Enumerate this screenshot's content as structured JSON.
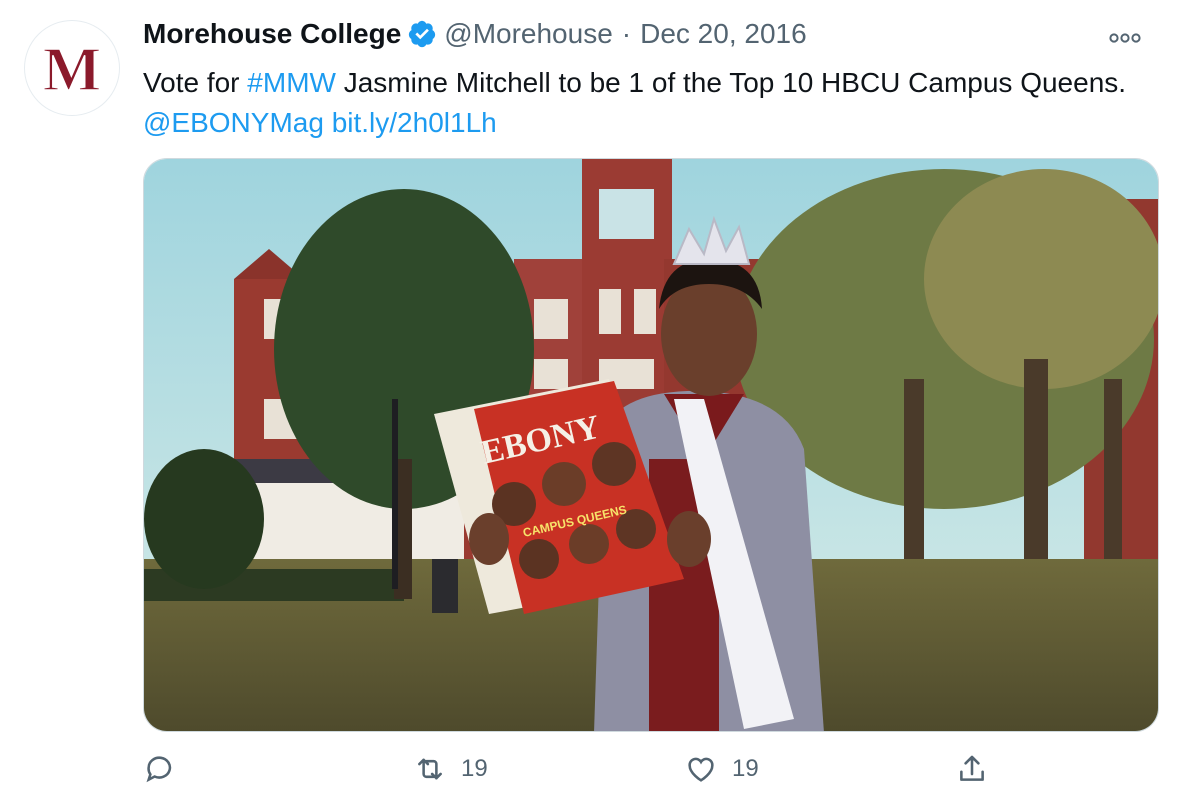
{
  "tweet": {
    "author_name": "Morehouse College",
    "handle": "@Morehouse",
    "separator": "·",
    "date": "Dec 20, 2016",
    "avatar_letter": "M",
    "text": {
      "part1": "Vote for ",
      "hashtag": "#MMW",
      "part2": " Jasmine Mitchell to be 1 of the Top 10 HBCU Campus Queens. ",
      "mention": "@EBONYMag",
      "space": " ",
      "url": "bit.ly/2h0l1Lh"
    },
    "media": {
      "magazine_title": "EBONY",
      "magazine_subtitle": "CAMPUS QUEENS"
    },
    "actions": {
      "reply_count": "",
      "retweet_count": "19",
      "like_count": "19"
    }
  },
  "colors": {
    "brand_maroon": "#8b1a2b",
    "link_blue": "#1d9bf0",
    "muted_gray": "#536471"
  },
  "icons": [
    "verified-badge-icon",
    "more-options-icon",
    "reply-icon",
    "retweet-icon",
    "like-icon",
    "share-icon"
  ]
}
